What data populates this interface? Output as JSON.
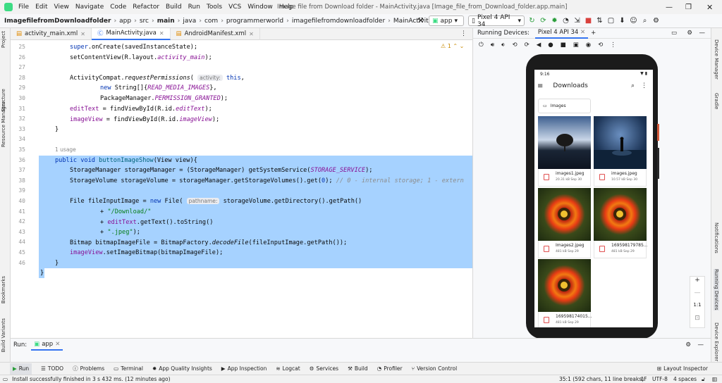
{
  "window": {
    "title": "Image file from Download folder - MainActivity.java [Image_file_from_Download_folder.app.main]"
  },
  "menu": [
    "File",
    "Edit",
    "View",
    "Navigate",
    "Code",
    "Refactor",
    "Build",
    "Run",
    "Tools",
    "VCS",
    "Window",
    "Help"
  ],
  "breadcrumb": [
    "ImagefilefromDownloadfolder",
    "app",
    "src",
    "main",
    "java",
    "com",
    "programmerworld",
    "imagefilefromdownloadfolder",
    "MainActivity"
  ],
  "toolbar": {
    "run_config": "app",
    "device": "Pixel 4 API 34"
  },
  "left_tools": [
    "Project",
    "Structure",
    "Resource Manager",
    "Bookmarks",
    "Build Variants"
  ],
  "right_tools": [
    "Device Manager",
    "Gradle",
    "Notifications",
    "Running Devices",
    "Device Explorer"
  ],
  "editor_tabs": [
    "activity_main.xml",
    "MainActivity.java",
    "AndroidManifest.xml"
  ],
  "editor": {
    "warning_count": "1",
    "usage_hint": "1 usage",
    "line_numbers": [
      "25",
      "26",
      "27",
      "28",
      "29",
      "30",
      "31",
      "32",
      "33",
      "34",
      "35",
      "36",
      "37",
      "38",
      "39",
      "40",
      "41",
      "42",
      "43",
      "44",
      "45",
      "46"
    ]
  },
  "running_devices": {
    "label": "Running Devices:",
    "device_tab": "Pixel 4 API 34"
  },
  "phone": {
    "time": "9:16",
    "app_title": "Downloads",
    "folder": "Images",
    "zoom_label": "1:1",
    "files": [
      {
        "name": "images1.jpeg",
        "meta": "20.31 kB Sep 30"
      },
      {
        "name": "images.jpeg",
        "meta": "10.57 kB Sep 30"
      },
      {
        "name": "Images2.jpeg",
        "meta": "481 kB Sep 29"
      },
      {
        "name": "169598179785...",
        "meta": "481 kB Sep 29"
      },
      {
        "name": "169598174015...",
        "meta": "481 kB Sep 29"
      }
    ]
  },
  "run_panel": {
    "label": "Run:",
    "config": "app"
  },
  "bottom_tabs": [
    "Run",
    "TODO",
    "Problems",
    "Terminal",
    "App Quality Insights",
    "App Inspection",
    "Logcat",
    "Services",
    "Build",
    "Profiler",
    "Version Control"
  ],
  "layout_inspector": "Layout Inspector",
  "status": {
    "message": "Install successfully finished in 3 s 432 ms. (12 minutes ago)",
    "position": "35:1 (592 chars, 11 line breaks)",
    "line_ending": "LF",
    "encoding": "UTF-8",
    "indent": "4 spaces"
  }
}
